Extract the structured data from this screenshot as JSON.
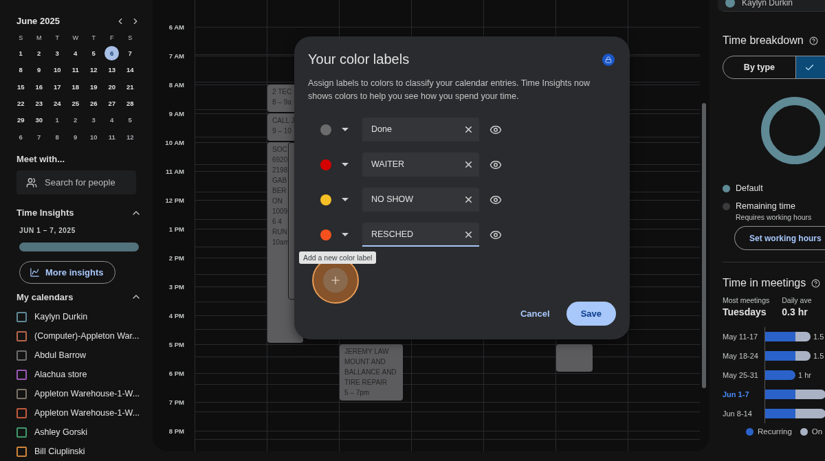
{
  "mini_calendar": {
    "title": "June 2025",
    "weekdays": [
      "S",
      "M",
      "T",
      "W",
      "T",
      "F",
      "S"
    ],
    "weeks": [
      [
        {
          "day": "1",
          "selected": false,
          "muted": false
        },
        {
          "day": "2",
          "selected": false,
          "muted": false
        },
        {
          "day": "3",
          "selected": false,
          "muted": false
        },
        {
          "day": "4",
          "selected": false,
          "muted": false
        },
        {
          "day": "5",
          "selected": false,
          "muted": false
        },
        {
          "day": "6",
          "selected": true,
          "muted": false
        },
        {
          "day": "7",
          "selected": false,
          "muted": false
        }
      ],
      [
        {
          "day": "8",
          "selected": false,
          "muted": false
        },
        {
          "day": "9",
          "selected": false,
          "muted": false
        },
        {
          "day": "10",
          "selected": false,
          "muted": false
        },
        {
          "day": "11",
          "selected": false,
          "muted": false
        },
        {
          "day": "12",
          "selected": false,
          "muted": false
        },
        {
          "day": "13",
          "selected": false,
          "muted": false
        },
        {
          "day": "14",
          "selected": false,
          "muted": false
        }
      ],
      [
        {
          "day": "15",
          "selected": false,
          "muted": false
        },
        {
          "day": "16",
          "selected": false,
          "muted": false
        },
        {
          "day": "17",
          "selected": false,
          "muted": false
        },
        {
          "day": "18",
          "selected": false,
          "muted": false
        },
        {
          "day": "19",
          "selected": false,
          "muted": false
        },
        {
          "day": "20",
          "selected": false,
          "muted": false
        },
        {
          "day": "21",
          "selected": false,
          "muted": false
        }
      ],
      [
        {
          "day": "22",
          "selected": false,
          "muted": false
        },
        {
          "day": "23",
          "selected": false,
          "muted": false
        },
        {
          "day": "24",
          "selected": false,
          "muted": false
        },
        {
          "day": "25",
          "selected": false,
          "muted": false
        },
        {
          "day": "26",
          "selected": false,
          "muted": false
        },
        {
          "day": "27",
          "selected": false,
          "muted": false
        },
        {
          "day": "28",
          "selected": false,
          "muted": false
        }
      ],
      [
        {
          "day": "29",
          "selected": false,
          "muted": false
        },
        {
          "day": "30",
          "selected": false,
          "muted": false
        },
        {
          "day": "1",
          "selected": false,
          "muted": true
        },
        {
          "day": "2",
          "selected": false,
          "muted": true
        },
        {
          "day": "3",
          "selected": false,
          "muted": true
        },
        {
          "day": "4",
          "selected": false,
          "muted": true
        },
        {
          "day": "5",
          "selected": false,
          "muted": true
        }
      ],
      [
        {
          "day": "6",
          "selected": false,
          "muted": true
        },
        {
          "day": "7",
          "selected": false,
          "muted": true
        },
        {
          "day": "8",
          "selected": false,
          "muted": true
        },
        {
          "day": "9",
          "selected": false,
          "muted": true
        },
        {
          "day": "10",
          "selected": false,
          "muted": true
        },
        {
          "day": "11",
          "selected": false,
          "muted": true
        },
        {
          "day": "12",
          "selected": false,
          "muted": true
        }
      ]
    ]
  },
  "meet_with": {
    "title": "Meet with...",
    "placeholder": "Search for people"
  },
  "time_insights": {
    "title": "Time Insights",
    "expanded": true,
    "range": "JUN 1 – 7, 2025",
    "button": "More insights"
  },
  "my_calendars": {
    "title": "My calendars",
    "expanded": true,
    "items": [
      {
        "name": "Kaylyn Durkin",
        "checked": false,
        "color": "#5f8a96"
      },
      {
        "name": "(Computer)-Appleton War...",
        "checked": false,
        "color": "#b8664c"
      },
      {
        "name": "Abdul Barrow",
        "checked": false,
        "color": "#6e6e6e"
      },
      {
        "name": "Alachua store",
        "checked": false,
        "color": "#9b59b6"
      },
      {
        "name": "Appleton Warehouse-1-W...",
        "checked": false,
        "color": "#7b7266"
      },
      {
        "name": "Appleton Warehouse-1-W...",
        "checked": false,
        "color": "#c25a3c"
      },
      {
        "name": "Ashley Gorski",
        "checked": false,
        "color": "#3f9a6a"
      },
      {
        "name": "Bill Ciuplinski",
        "checked": false,
        "color": "#d0843a"
      }
    ]
  },
  "week_grid": {
    "hours": [
      "6 AM",
      "7 AM",
      "8 AM",
      "9 AM",
      "10 AM",
      "11 AM",
      "12 PM",
      "1 PM",
      "2 PM",
      "3 PM",
      "4 PM",
      "5 PM",
      "6 PM",
      "7 PM",
      "8 PM"
    ],
    "events": [
      {
        "kind": "text",
        "lines": [
          "2 TEC",
          "8 – 9a"
        ]
      },
      {
        "kind": "text",
        "lines": [
          "CALL J",
          "9 – 10"
        ]
      },
      {
        "kind": "text",
        "lines": [
          "SOC",
          "6920",
          "2198",
          "GAB",
          "BER",
          "ON",
          "1009",
          "6 4",
          "RUN",
          "10am"
        ]
      },
      {
        "kind": "outlined"
      },
      {
        "kind": "text",
        "lines": [
          "JEREMY LAW MOUNT AND BALLANCE AND TIRE REPAIR",
          "5 – 7pm"
        ]
      },
      {
        "kind": "blank"
      }
    ]
  },
  "dialog": {
    "title": "Your color labels",
    "description": "Assign labels to colors to classify your calendar entries. Time Insights now shows colors to help you see how you spend your time.",
    "labels": [
      {
        "color": "#6b6b6b",
        "value": "Done",
        "focused": false
      },
      {
        "color": "#d50000",
        "value": "WAITER",
        "focused": false
      },
      {
        "color": "#f6bf26",
        "value": "NO SHOW",
        "focused": false
      },
      {
        "color": "#f4511e",
        "value": "RESCHED",
        "focused": true
      }
    ],
    "add_tooltip": "Add a new color label",
    "buttons": [
      {
        "label": "Cancel",
        "kind": "text"
      },
      {
        "label": "Save",
        "kind": "filled"
      }
    ]
  },
  "right_panel": {
    "top_item": "Kaylyn Durkin",
    "time_breakdown": {
      "title": "Time breakdown",
      "segments": [
        {
          "label": "By type",
          "selected": false
        },
        {
          "selected": true
        }
      ],
      "legend": [
        {
          "label": "Default",
          "color": "#5f8a96"
        },
        {
          "label": "Remaining time",
          "color": "#3a3a3c",
          "note": "Requires working hours"
        }
      ],
      "button": "Set working hours"
    },
    "time_in_meetings": {
      "title": "Time in meetings",
      "stats": [
        {
          "label": "Most meetings",
          "value": "Tuesdays"
        },
        {
          "label": "Daily ave",
          "value": "0.3 hr"
        }
      ],
      "weeks": [
        {
          "label": "May 11-17",
          "selected": false,
          "reading": "1.5"
        },
        {
          "label": "May 18-24",
          "selected": false,
          "reading": "1.5"
        },
        {
          "label": "May 25-31",
          "selected": false,
          "reading": "1 hr"
        },
        {
          "label": "Jun 1-7",
          "selected": true
        },
        {
          "label": "Jun 8-14",
          "selected": false
        }
      ],
      "legend": [
        {
          "label": "Recurring",
          "color": "#2a62c9"
        },
        {
          "label": "On",
          "color": "#aab3c5"
        }
      ]
    }
  }
}
